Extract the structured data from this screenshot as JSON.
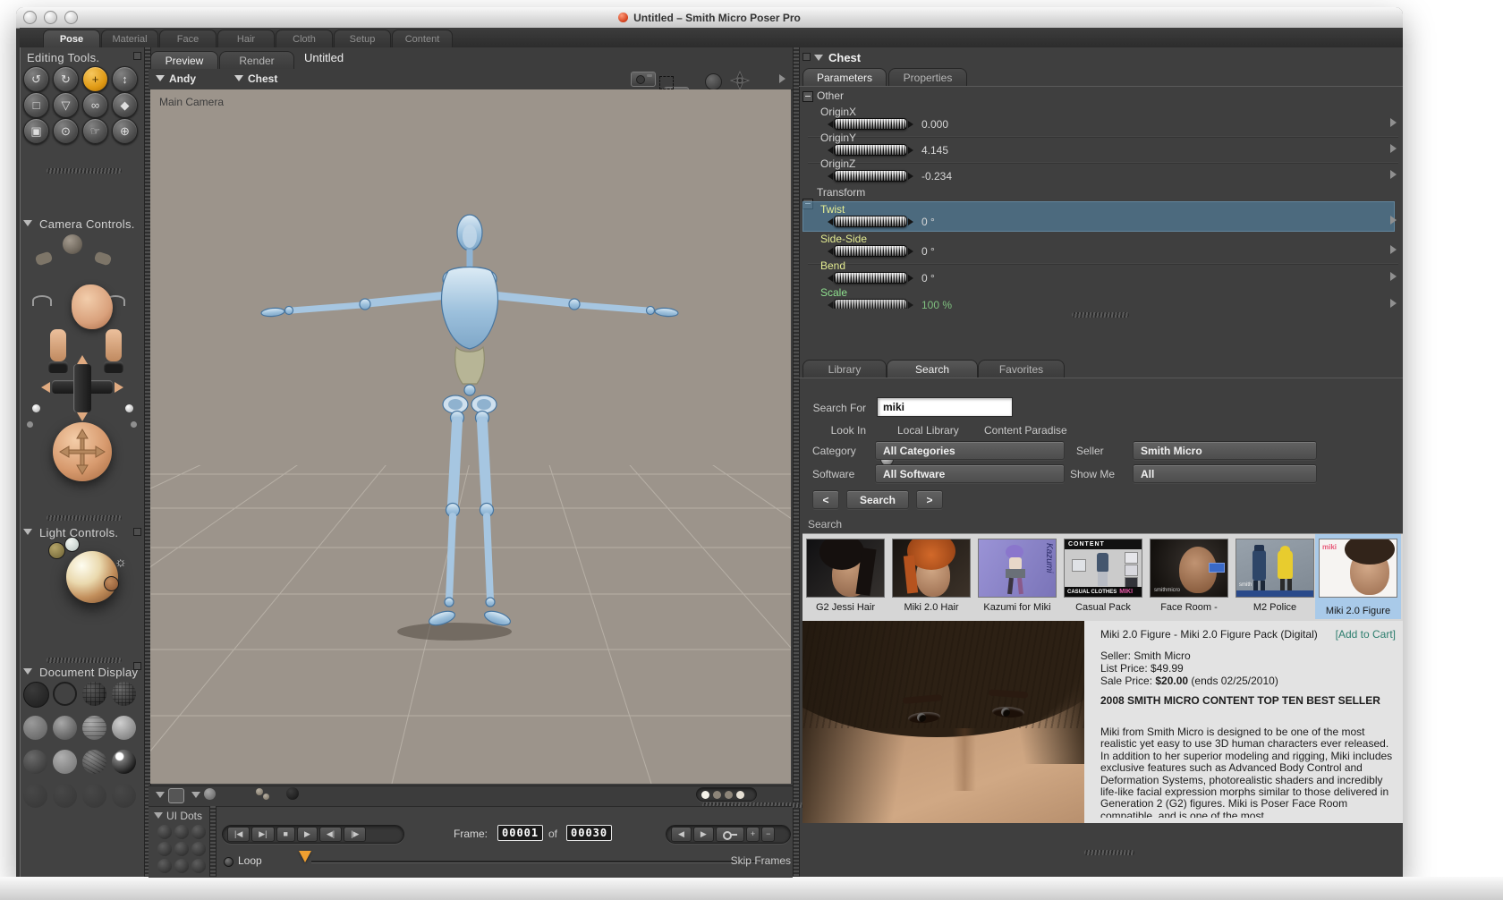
{
  "window": {
    "title": "Untitled – Smith Micro Poser Pro"
  },
  "main_tabs": [
    {
      "label": "Pose",
      "active": true
    },
    {
      "label": "Material"
    },
    {
      "label": "Face"
    },
    {
      "label": "Hair"
    },
    {
      "label": "Cloth"
    },
    {
      "label": "Setup"
    },
    {
      "label": "Content"
    }
  ],
  "sidebar": {
    "editing_tools_title": "Editing Tools.",
    "tools": [
      {
        "name": "rotate",
        "glyph": "↺"
      },
      {
        "name": "twist",
        "glyph": "↻"
      },
      {
        "name": "translate-pull",
        "glyph": "+",
        "active": true
      },
      {
        "name": "translate-in-out",
        "glyph": "↕"
      },
      {
        "name": "scale",
        "glyph": "□"
      },
      {
        "name": "taper",
        "glyph": "▽"
      },
      {
        "name": "morphing-tool",
        "glyph": "∞"
      },
      {
        "name": "color",
        "glyph": "◆"
      },
      {
        "name": "grouping-tool",
        "glyph": "▣"
      },
      {
        "name": "view-magnifier",
        "glyph": "⊙"
      },
      {
        "name": "direct-manipulation",
        "glyph": "☞"
      },
      {
        "name": "depth-cue",
        "glyph": "⊕"
      }
    ],
    "camera_controls_title": "Camera Controls.",
    "light_controls_title": "Light Controls.",
    "document_display_title": "Document Display"
  },
  "document": {
    "view_tabs": [
      {
        "label": "Preview",
        "active": true
      },
      {
        "label": "Render"
      }
    ],
    "doc_title": "Untitled",
    "actor_menu": "Andy",
    "element_menu": "Chest",
    "camera_label": "Main Camera"
  },
  "timeline": {
    "ui_dots_label": "UI Dots",
    "transport": [
      "|◀",
      "▶|",
      "■",
      "▶",
      "◀|",
      "|▶"
    ],
    "frame_label": "Frame:",
    "frame_current": "00001",
    "of_label": "of",
    "frame_total": "00030",
    "edit_buttons": [
      "◀",
      "▶",
      "+",
      "−"
    ],
    "loop_label": "Loop",
    "skip_frames_label": "Skip Frames"
  },
  "parameters_panel": {
    "actor": "Chest",
    "tabs": [
      {
        "label": "Parameters",
        "active": true
      },
      {
        "label": "Properties"
      }
    ],
    "group_other": "Other",
    "group_transform": "Transform",
    "params": [
      {
        "label": "OriginX",
        "value": "0.000"
      },
      {
        "label": "OriginY",
        "value": "4.145"
      },
      {
        "label": "OriginZ",
        "value": "-0.234"
      },
      {
        "label": "Twist",
        "value": "0 °",
        "highlighted": true
      },
      {
        "label": "Side-Side",
        "value": "0 °"
      },
      {
        "label": "Bend",
        "value": "0 °"
      },
      {
        "label": "Scale",
        "value": "100 %"
      }
    ]
  },
  "library": {
    "tabs": [
      {
        "label": "Library"
      },
      {
        "label": "Search",
        "active": true
      },
      {
        "label": "Favorites"
      }
    ],
    "search_for_label": "Search For",
    "search_value": "miki",
    "look_in_label": "Look In",
    "radio_local": "Local Library",
    "radio_paradise": "Content Paradise",
    "category_label": "Category",
    "category_value": "All Categories",
    "seller_label": "Seller",
    "seller_value": "Smith Micro",
    "software_label": "Software",
    "show_me_label": "Show Me",
    "software_value": "All Software",
    "show_me_value": "All",
    "prev_button": "<",
    "search_button": "Search",
    "next_button": ">",
    "results_label": "Search",
    "results": [
      {
        "label": "G2 Jessi Hair"
      },
      {
        "label": "Miki 2.0 Hair"
      },
      {
        "label": "Kazumi for Miki",
        "art_text": "Kazumi"
      },
      {
        "label": "Casual Pack",
        "art_top": "CONTENT",
        "art_bottom": "CASUAL CLOTHES",
        "art_accent": "MIKI"
      },
      {
        "label": "Face Room -",
        "art_text": "smithmicro"
      },
      {
        "label": "M2 Police",
        "art_text": "smith"
      },
      {
        "label": "Miki 2.0 Figure",
        "art_text": "miki",
        "selected": true
      }
    ],
    "detail": {
      "title": "Miki 2.0 Figure - Miki 2.0 Figure Pack (Digital)",
      "add_to_cart": "[Add to Cart]",
      "seller": "Seller: Smith Micro",
      "list_price": "List Price: $49.99",
      "sale_price_label": "Sale Price:",
      "sale_price_value": "$20.00",
      "sale_price_suffix": "(ends 02/25/2010)",
      "banner": "2008 SMITH MICRO CONTENT TOP TEN BEST SELLER",
      "description": "Miki from Smith Micro is designed to be one of the most realistic yet easy to use 3D human characters ever released. In addition to her superior modeling and rigging, Miki includes exclusive features such as Advanced Body Control and Deformation Systems, photorealistic shaders and incredibly life-like facial expression morphs similar to those delivered in Generation 2 (G2) figures. Miki is Poser Face Room compatible, and is one of the most"
    }
  },
  "colors": {
    "tool_active": "#e09a14",
    "param_highlight": "#51809f",
    "label_yellow": "#e4ec92",
    "label_green": "#8fe08f",
    "selected_thumb": "#a9cae9",
    "add_to_cart": "#2c7d6d"
  }
}
